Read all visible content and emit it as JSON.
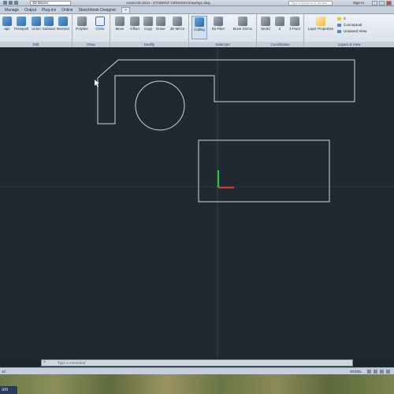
{
  "app": {
    "title": "AutoCAD 2013 - STUDENT VERSION   Drawing1.dwg",
    "workspace": "3D Basics",
    "search_placeholder": "Type a keyword or phrase",
    "sign_in": "Sign In"
  },
  "tabs": [
    "Manage",
    "Output",
    "Plug-ins",
    "Online",
    "Sketchbook Designer",
    "»"
  ],
  "ribbon": {
    "panels": {
      "edit": "Edit",
      "draw": "Draw",
      "modify": "Modify",
      "selection": "Selection",
      "coordinates": "Coordinates",
      "layers_view": "Layers & View"
    },
    "edit_tools": [
      "Presspull",
      "Union",
      "Subtract",
      "Intersect"
    ],
    "edit_first_tool": "ape",
    "draw_tools": [
      "Polyline",
      "Circle"
    ],
    "modify_tools": [
      "Move",
      "Offset",
      "Copy",
      "Erase",
      "3D Mirror"
    ],
    "selection_tools": [
      "Culling",
      "No Filter",
      "Move Gizmo"
    ],
    "coordinates_tools": [
      "World",
      "Z",
      "3 Point"
    ],
    "layer_properties": "Layer Properties",
    "visual_style": "Conceptual",
    "named_view": "Unsaved View",
    "layer_count": "0"
  },
  "command_line": {
    "prompt": "Type a command"
  },
  "status": {
    "model_label": "MODEL",
    "left_label": "4d"
  },
  "taskbar": {
    "start_label": "om"
  },
  "colors": {
    "canvas_bg": "#212930",
    "geometry": "#cfd6dc",
    "ucs_x": "#d23b3b",
    "ucs_y": "#2fbf4a",
    "crosshair": "#2d5a3a"
  }
}
